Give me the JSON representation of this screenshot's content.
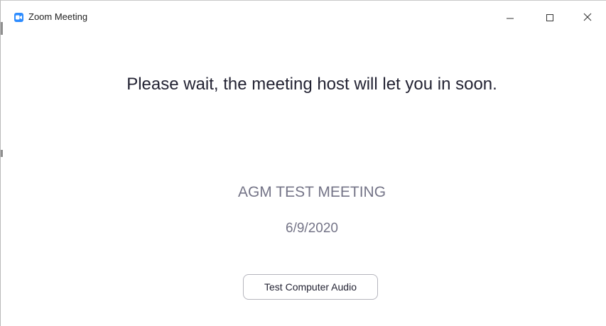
{
  "window": {
    "title": "Zoom Meeting",
    "app_icon": "zoom-camera-icon",
    "controls": {
      "minimize_icon": "minimize-icon",
      "maximize_icon": "maximize-icon",
      "close_icon": "close-icon"
    }
  },
  "waiting_room": {
    "message": "Please wait, the meeting host will let you in soon.",
    "meeting_name": "AGM TEST MEETING",
    "meeting_date": "6/9/2020",
    "test_audio_label": "Test Computer Audio"
  },
  "colors": {
    "brand_blue": "#2d8cff",
    "message_text": "#232333",
    "secondary_text": "#747487",
    "button_border": "#b5b5bd"
  }
}
